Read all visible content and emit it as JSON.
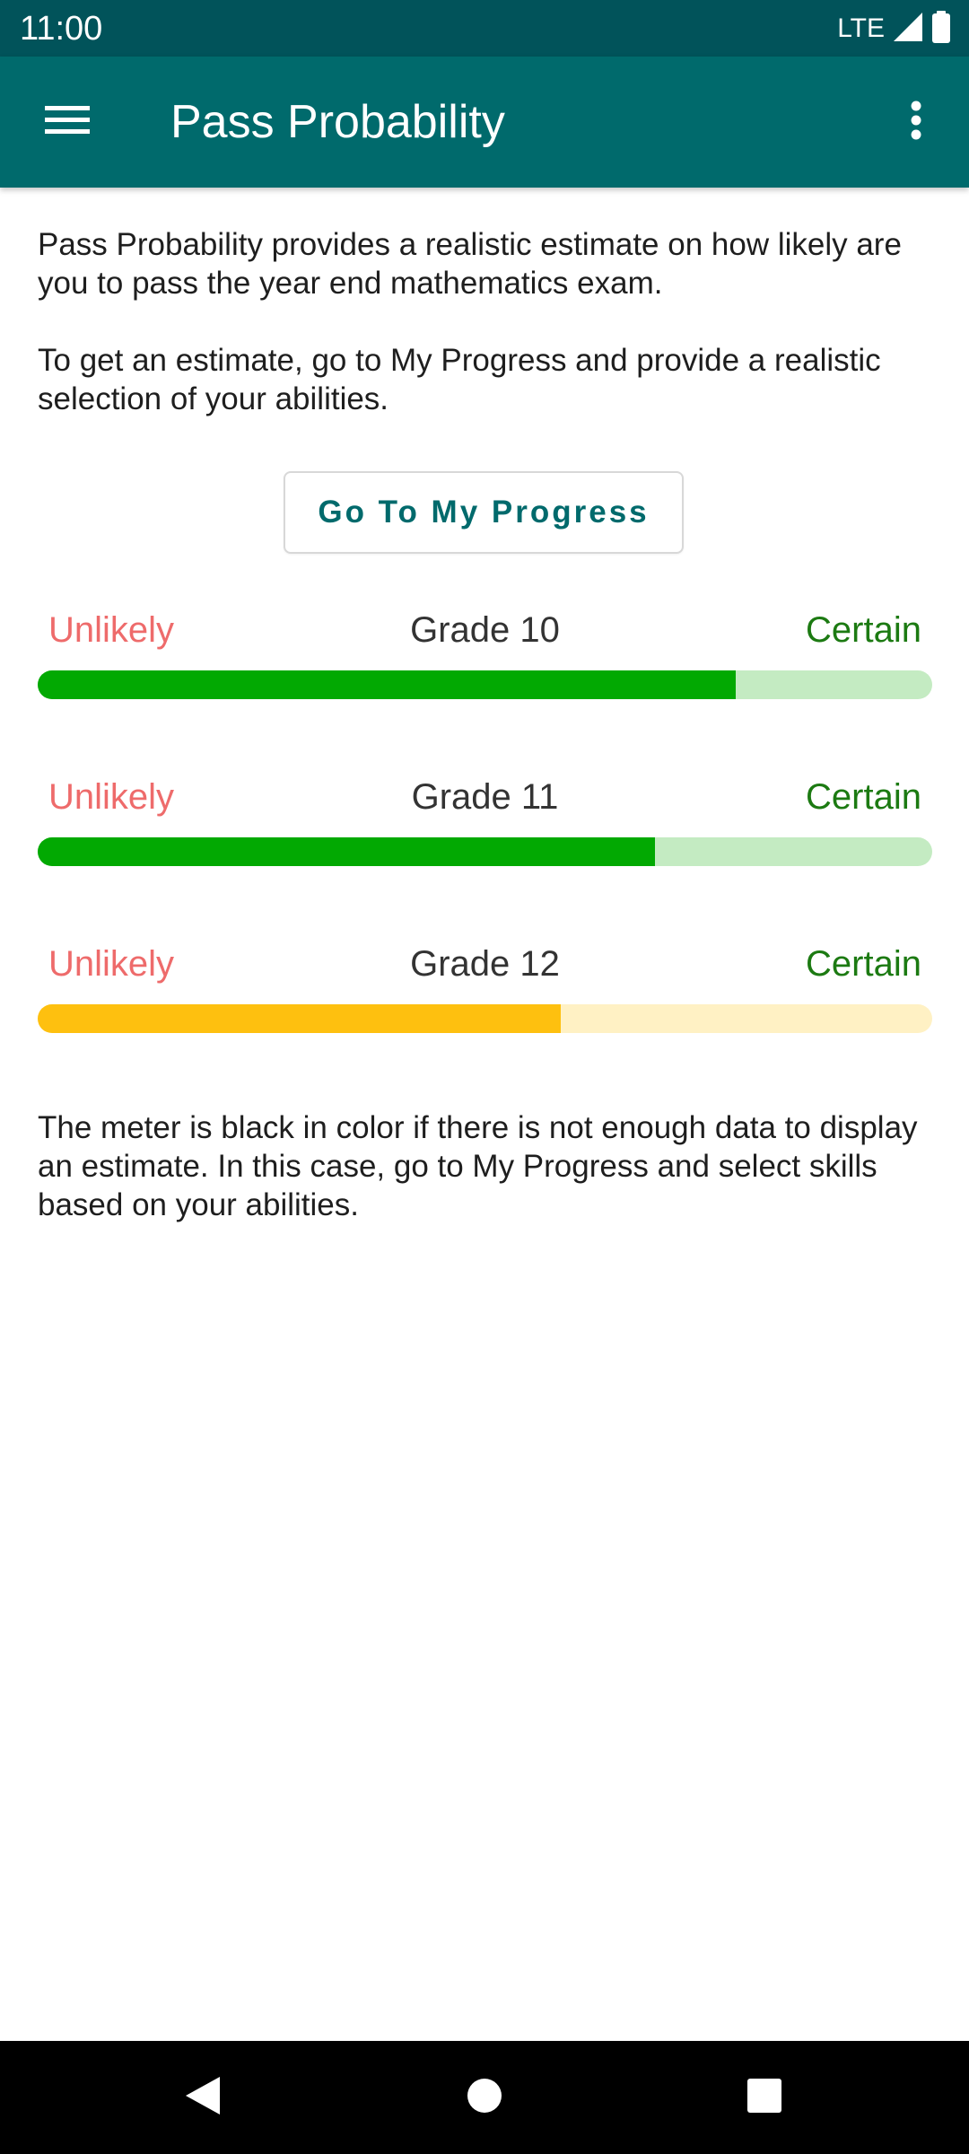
{
  "status_bar": {
    "time": "11:00",
    "network": "LTE",
    "icons": [
      "signal-icon",
      "battery-icon"
    ]
  },
  "app_bar": {
    "title": "Pass Probability",
    "menu_icon": "hamburger-menu-icon",
    "overflow_icon": "more-vert-icon"
  },
  "intro": {
    "paragraph_1": "Pass Probability provides a realistic estimate on how likely are you to pass the year end mathematics exam.",
    "paragraph_2": "To get an estimate, go to My Progress and provide a realistic selection of your abilities."
  },
  "go_button": {
    "label": "Go To My Progress"
  },
  "meters": [
    {
      "low_label": "Unlikely",
      "grade": "Grade 10",
      "high_label": "Certain",
      "level": 0.78,
      "fill_color": "#02a902",
      "track_color": "#c4ebc2"
    },
    {
      "low_label": "Unlikely",
      "grade": "Grade 11",
      "high_label": "Certain",
      "level": 0.69,
      "fill_color": "#02a902",
      "track_color": "#c4ebc2"
    },
    {
      "low_label": "Unlikely",
      "grade": "Grade 12",
      "high_label": "Certain",
      "level": 0.585,
      "fill_color": "#fec00f",
      "track_color": "#fff1c4"
    }
  ],
  "footer_note": "The meter is black in color if there is not enough data to display an estimate. In this case, go to My Progress and select skills based on your abilities.",
  "colors": {
    "status_bar": "#01535a",
    "app_bar": "#006a6c",
    "accent": "#006a6c",
    "unlikely": "#ee6b6b",
    "certain": "#1c7a12"
  },
  "nav_bar": {
    "icons": [
      "back-icon",
      "home-icon",
      "recents-icon"
    ]
  }
}
